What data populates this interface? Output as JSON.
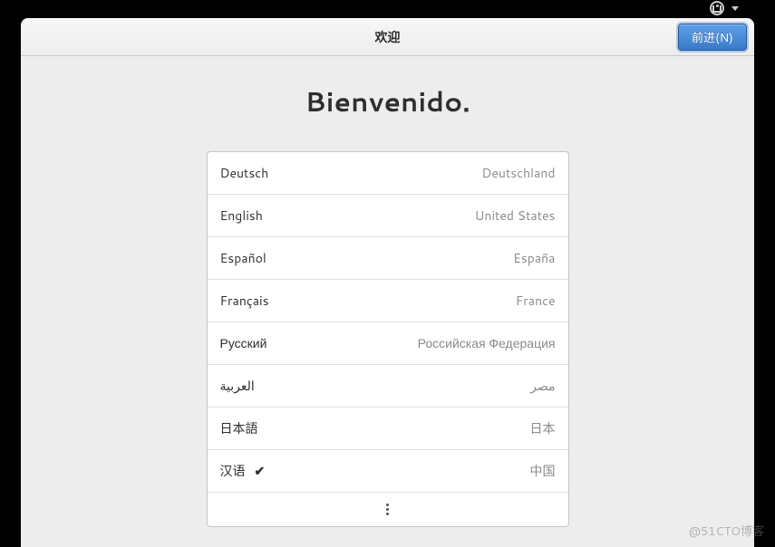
{
  "topbar": {
    "accessibility_label": "accessibility"
  },
  "header": {
    "title": "欢迎",
    "next_button": "前进(N)"
  },
  "main": {
    "heading": "Bienvenido."
  },
  "languages": [
    {
      "name": "Deutsch",
      "country": "Deutschland",
      "selected": false
    },
    {
      "name": "English",
      "country": "United States",
      "selected": false
    },
    {
      "name": "Español",
      "country": "España",
      "selected": false
    },
    {
      "name": "Français",
      "country": "France",
      "selected": false
    },
    {
      "name": "Русский",
      "country": "Российская Федерация",
      "selected": false
    },
    {
      "name": "العربية",
      "country": "مصر",
      "selected": false
    },
    {
      "name": "日本語",
      "country": "日本",
      "selected": false
    },
    {
      "name": "汉语",
      "country": "中国",
      "selected": true
    }
  ],
  "watermark": "@51CTO博客"
}
